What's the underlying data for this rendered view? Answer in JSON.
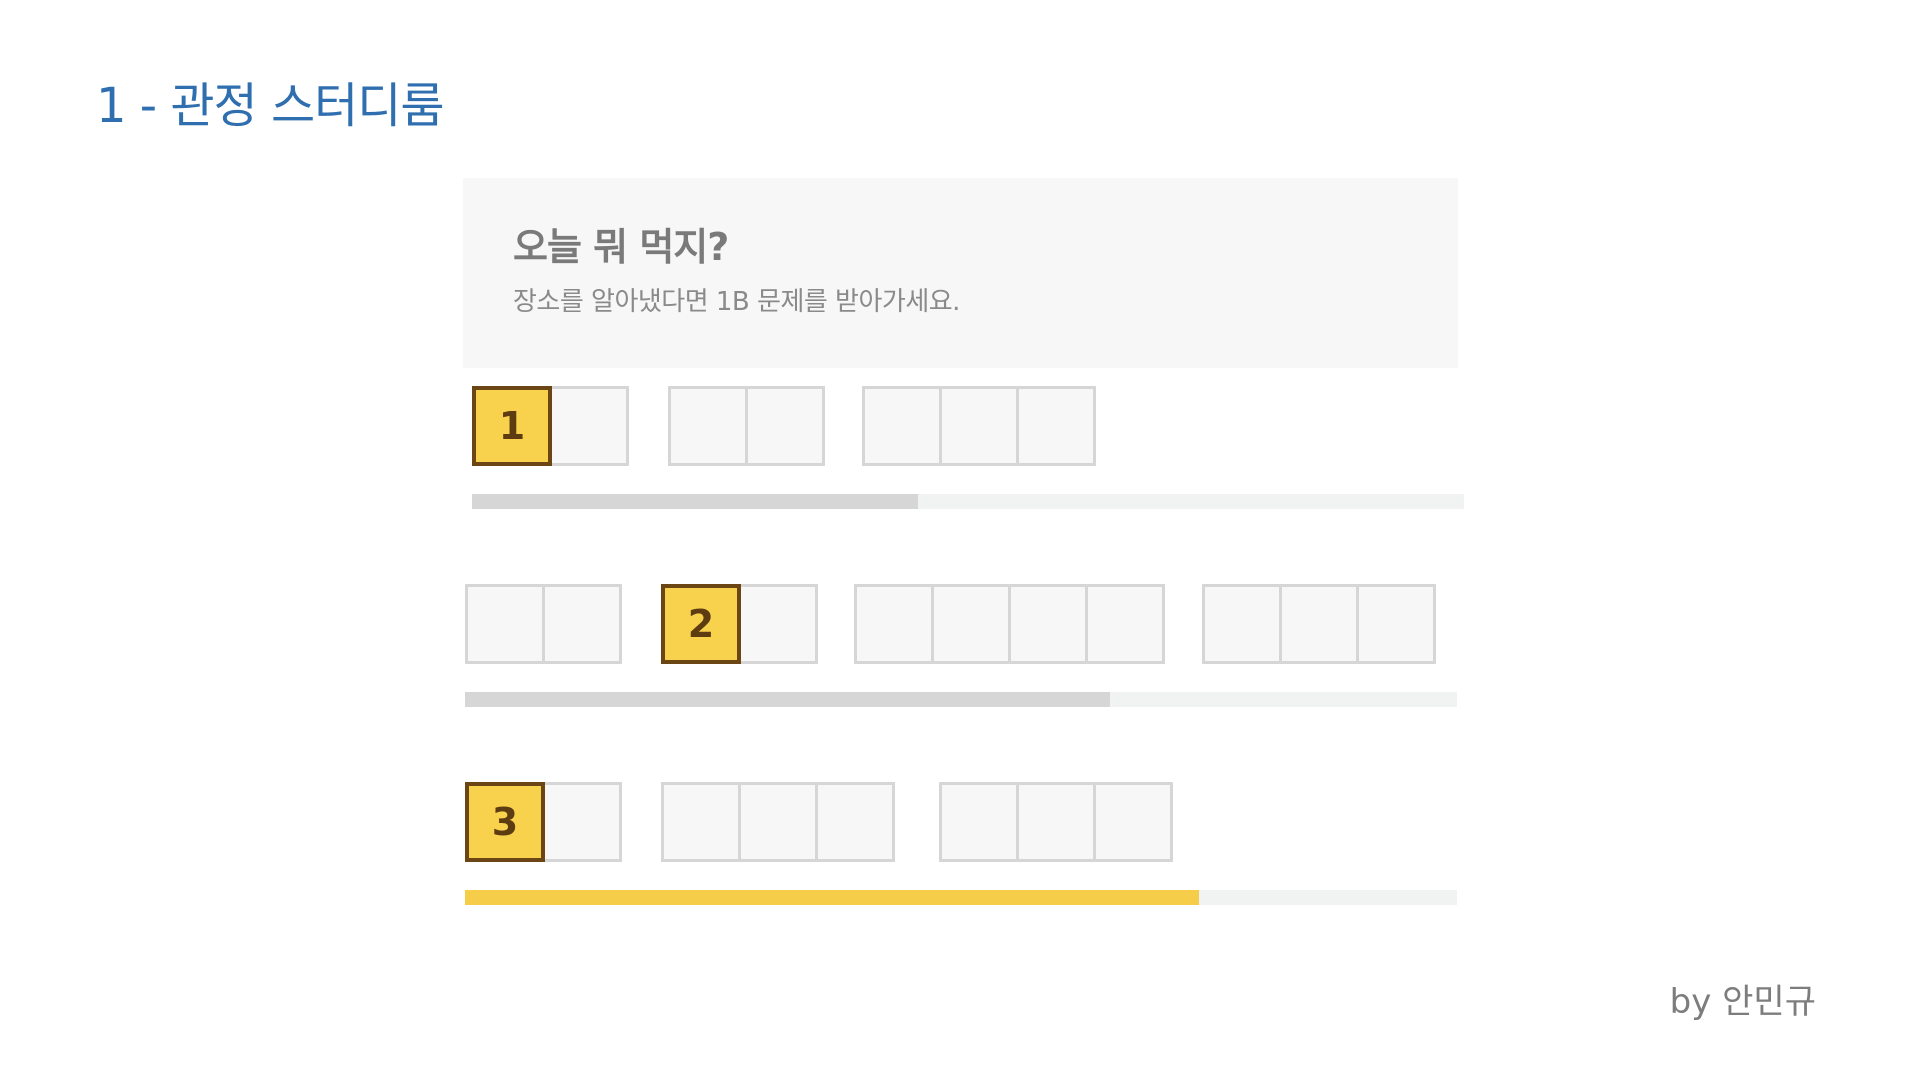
{
  "slide": {
    "title": "1 - 관정 스터디룸",
    "byline": "by 안민규"
  },
  "card": {
    "title": "오늘 뭐 먹지?",
    "subtitle": "장소를 알아냈다면 1B 문제를 받아가세요."
  },
  "colors": {
    "accent_blue": "#2f6fb0",
    "marker_yellow": "#f8d24c",
    "marker_border": "#6b4514",
    "progress_gray": "#d6d6d6",
    "progress_yellow": "#f5cd48",
    "track": "#f1f2f2"
  },
  "puzzle": {
    "rows": [
      {
        "groups": [
          2,
          2,
          3
        ],
        "marker": {
          "label": "1",
          "group": 0,
          "cell": 0
        },
        "progress": 0.45,
        "progress_color": "#d6d6d6"
      },
      {
        "groups": [
          2,
          2,
          4,
          3
        ],
        "marker": {
          "label": "2",
          "group": 1,
          "cell": 0
        },
        "progress": 0.65,
        "progress_color": "#d6d6d6"
      },
      {
        "groups": [
          2,
          3,
          3
        ],
        "marker": {
          "label": "3",
          "group": 0,
          "cell": 0
        },
        "progress": 0.74,
        "progress_color": "#f5cd48"
      }
    ]
  }
}
